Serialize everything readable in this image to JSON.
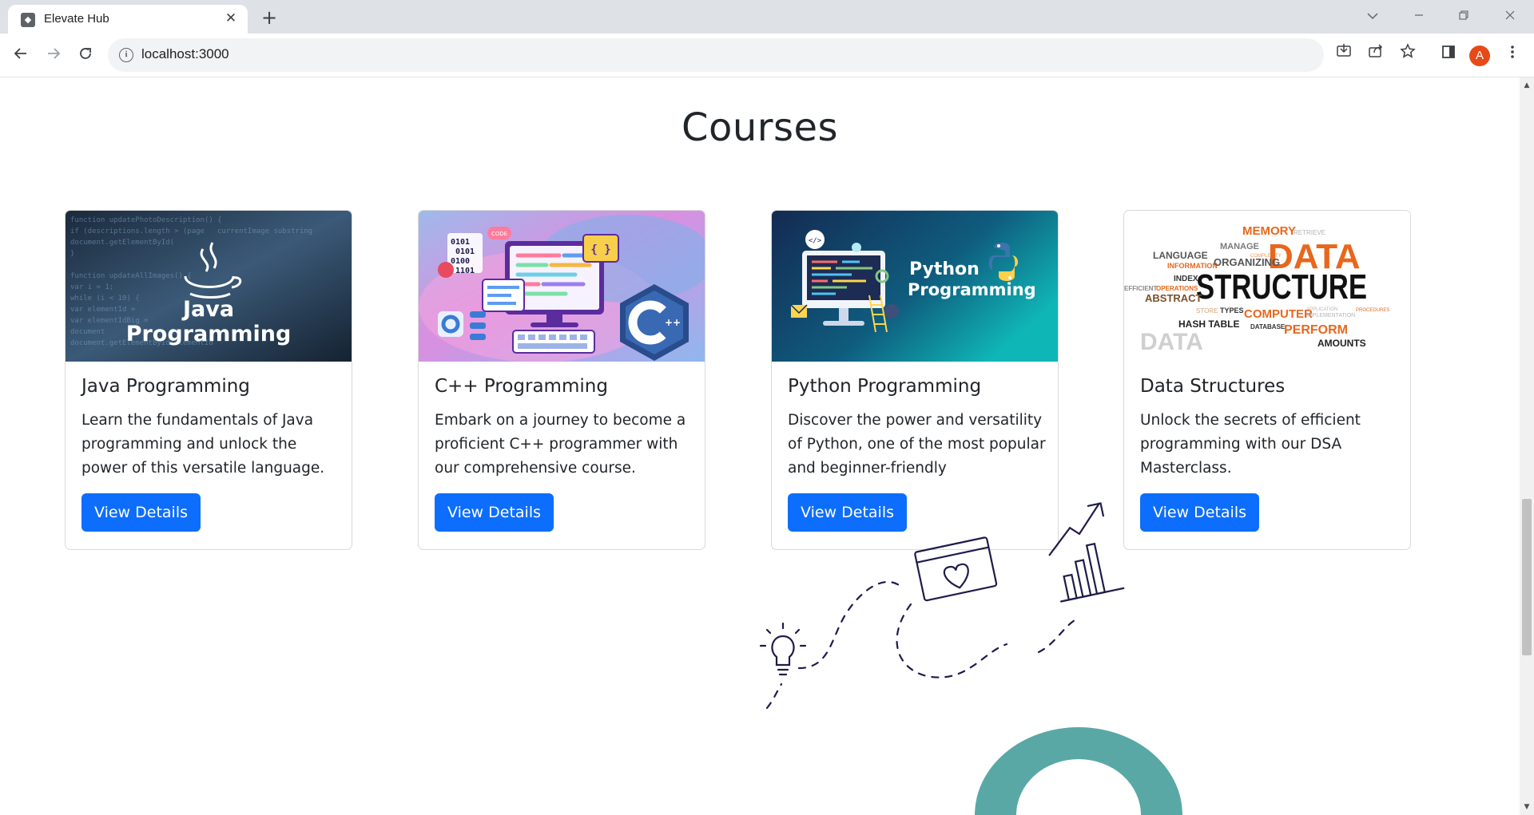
{
  "browser": {
    "tab_title": "Elevate Hub",
    "tab_favicon_glyph": "◆",
    "tab_close": "✕",
    "new_tab": "+",
    "url": "localhost:3000",
    "avatar_letter": "A",
    "icons": [
      "back-arrow-icon",
      "forward-arrow-icon",
      "reload-icon",
      "info-icon",
      "install-icon",
      "share-icon",
      "star-icon",
      "side-panel-icon",
      "kebab-menu-icon"
    ]
  },
  "page": {
    "title": "Courses",
    "view_details_label": "View Details"
  },
  "courses": [
    {
      "title": "Java Programming",
      "description": "Learn the fundamentals of Java programming and unlock the power of this versatile language.",
      "button": "View Details",
      "image": {
        "line1": "Java",
        "line2": "Programming"
      }
    },
    {
      "title": "C++ Programming",
      "description": "Embark on a journey to become a proficient C++ programmer with our comprehensive course.",
      "button": "View Details",
      "image": {
        "badge": "C++",
        "tag": "CODE",
        "binary": [
          "0101",
          "0101",
          "0100",
          "1101"
        ],
        "braces": "{ }"
      }
    },
    {
      "title": "Python Programming",
      "description": "Discover the power and versatility of Python, one of the most popular and beginner-friendly",
      "button": "View Details",
      "image": {
        "line1": "Python",
        "line2": "Programming"
      }
    },
    {
      "title": "Data Structures",
      "description": "Unlock the secrets of efficient programming with our DSA Masterclass.",
      "button": "View Details",
      "image": {
        "words": [
          "MEMORY",
          "RETRIEVE",
          "MANAGE",
          "COMPLEXITY",
          "LANGUAGE",
          "INFORMATION",
          "ORGANIZING",
          "DATA",
          "INDEX",
          "EFFICIENT",
          "OPERATIONS",
          "STRUCTURE",
          "ABSTRACT",
          "STORE",
          "TYPES",
          "COMPUTER",
          "APPLICATION",
          "IMPLEMENTATION",
          "PROCEDURES",
          "HASH TABLE",
          "DATABASE",
          "PERFORM",
          "DATA",
          "AMOUNTS"
        ]
      }
    }
  ],
  "colors": {
    "primary_button": "#0d6efd",
    "illustration_teal": "#5aa8a6",
    "illustration_ink": "#1e1b4b"
  }
}
